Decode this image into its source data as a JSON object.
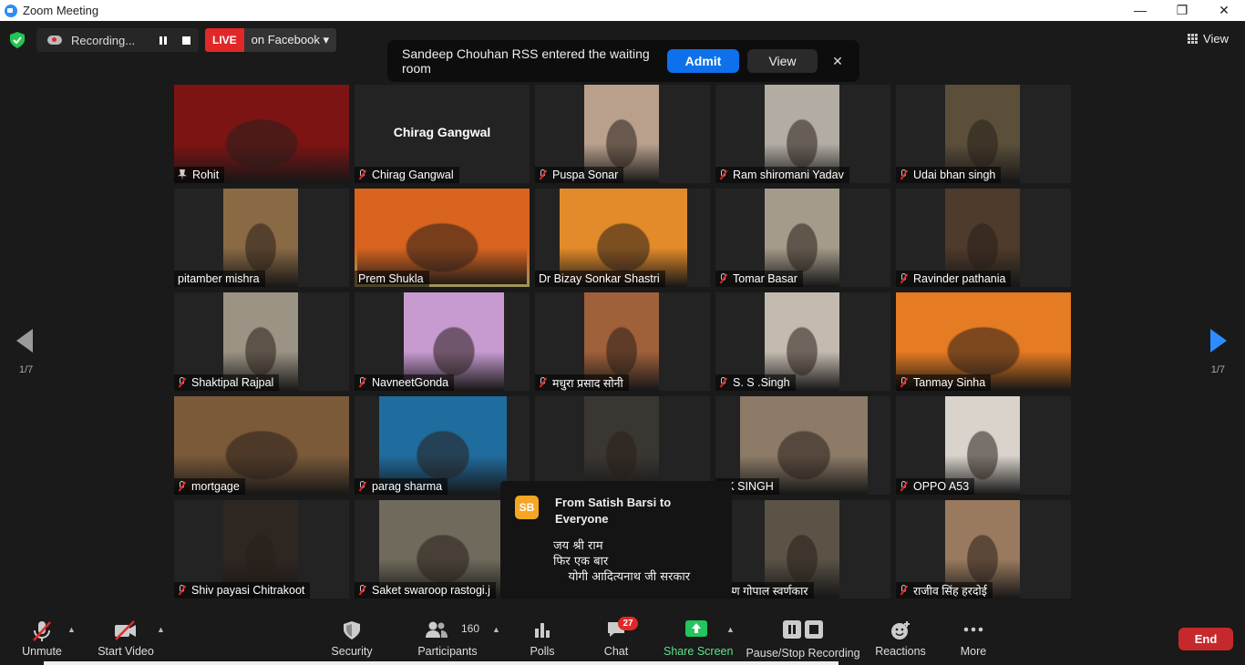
{
  "window": {
    "title": "Zoom Meeting",
    "controls": [
      "—",
      "❐",
      "✕"
    ]
  },
  "topbar": {
    "recording_label": "Recording...",
    "live_badge": "LIVE",
    "live_target": "on Facebook ▾",
    "view_label": "View"
  },
  "waiting_room": {
    "message": "Sandeep Chouhan RSS entered the waiting room",
    "admit_label": "Admit",
    "view_label": "View",
    "close": "✕"
  },
  "pagination": {
    "left": "1/7",
    "right": "1/7"
  },
  "participants": [
    {
      "name": "Rohit",
      "pinned": true,
      "video": "#7d1414"
    },
    {
      "name": "Chirag Gangwal",
      "muted": true,
      "display_name": "Chirag Gangwal"
    },
    {
      "name": "Puspa Sonar",
      "muted": true,
      "video": "#b9a08c"
    },
    {
      "name": "Ram shiromani Yadav",
      "muted": true,
      "video": "#b2aca3"
    },
    {
      "name": "Udai bhan singh",
      "muted": true,
      "video": "#5b4f3a"
    },
    {
      "name": "pitamber mishra",
      "muted": false,
      "video": "#8a6a45"
    },
    {
      "name": "Prem Shukla",
      "muted": false,
      "active": true,
      "video": "#d8641f"
    },
    {
      "name": "Dr Bizay Sonkar Shastri",
      "muted": false,
      "video": "#e38b2a"
    },
    {
      "name": "Tomar Basar",
      "muted": true,
      "video": "#a59b8a"
    },
    {
      "name": "Ravinder pathania",
      "muted": true,
      "video": "#4e3b2b"
    },
    {
      "name": "Shaktipal Rajpal",
      "muted": true,
      "video": "#9b9384"
    },
    {
      "name": "NavneetGonda",
      "muted": true,
      "video": "#c79ad0"
    },
    {
      "name": "मधुरा प्रसाद सोनी",
      "muted": true,
      "video": "#a0603a"
    },
    {
      "name": "S. S .Singh",
      "muted": true,
      "video": "#c4bbb0"
    },
    {
      "name": "Tanmay Sinha",
      "muted": true,
      "video": "#e57b22"
    },
    {
      "name": "mortgage",
      "muted": true,
      "video": "#7b5a3a"
    },
    {
      "name": "parag sharma",
      "muted": true,
      "video": "#1f6c9e"
    },
    {
      "name": "",
      "muted": false,
      "video": "#3a3632"
    },
    {
      "name": "SK SINGH",
      "muted": false,
      "video": "#8d7b68"
    },
    {
      "name": "OPPO A53",
      "muted": true,
      "video": "#d9d3cc"
    },
    {
      "name": "Shiv payasi Chitrakoot",
      "muted": true,
      "video": "#2e2621"
    },
    {
      "name": "Saket swaroop rastogi.j",
      "muted": true,
      "video": "#6f6a5c"
    },
    {
      "name": "",
      "muted": false,
      "video": "#232323"
    },
    {
      "name": "कृष्ण गोपाल स्वर्णकार",
      "muted": false,
      "video": "#5a5346"
    },
    {
      "name": "राजीव सिंह  हरदोई",
      "muted": true,
      "video": "#9a7a5e"
    }
  ],
  "chat_popup": {
    "avatar": "SB",
    "from": "From Satish Barsi to Everyone",
    "body": "जय श्री राम\nफिर एक बार\n    योगी आदित्यनाथ जी सरकार"
  },
  "toolbar": {
    "unmute": "Unmute",
    "start_video": "Start Video",
    "security": "Security",
    "participants": "Participants",
    "participant_count": "160",
    "polls": "Polls",
    "chat": "Chat",
    "chat_badge": "27",
    "share_screen": "Share Screen",
    "pause_stop_recording": "Pause/Stop Recording",
    "reactions": "Reactions",
    "more": "More",
    "end": "End"
  },
  "colors": {
    "accent": "#0e71eb",
    "share_green": "#22c55e",
    "danger": "#e02828",
    "active_border": "#f4e58a"
  }
}
